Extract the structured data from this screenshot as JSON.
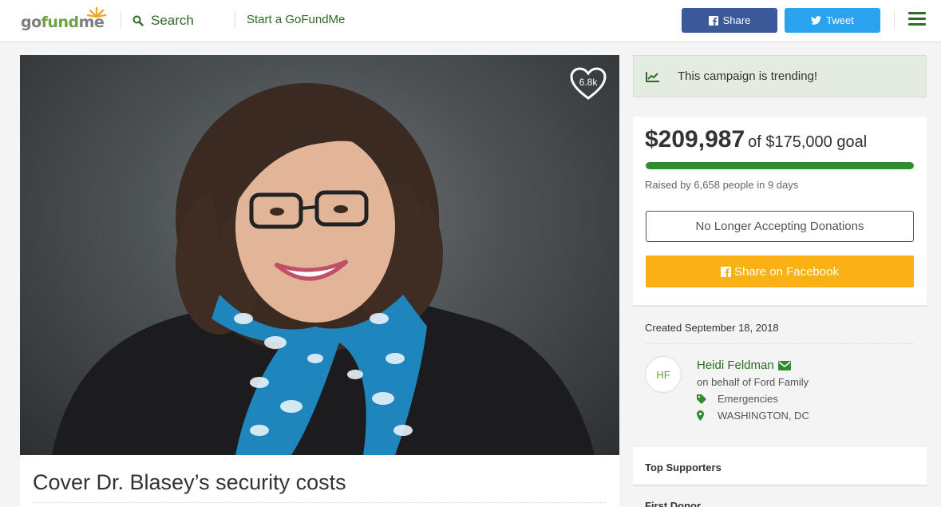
{
  "header": {
    "logo": {
      "go": "go",
      "fund": "fund",
      "me": "me"
    },
    "search_label": "Search",
    "start_label": "Start a GoFundMe",
    "share_label": "Share",
    "tweet_label": "Tweet",
    "colors": {
      "green": "#2d6c24",
      "facebook": "#3b5998",
      "twitter": "#2aa3ef"
    }
  },
  "campaign": {
    "heart_count": "6.8k",
    "title": "Cover Dr. Blasey’s security costs"
  },
  "trending": {
    "text": "This campaign is trending!"
  },
  "progress": {
    "raised": "$209,987",
    "goal_text": "of $175,000 goal",
    "fill_fraction": 1.0,
    "raised_by": "Raised by 6,658 people in 9 days",
    "closed_label": "No Longer Accepting Donations",
    "facebook_label": "Share on Facebook",
    "colors": {
      "bar": "#2f8c2b",
      "button": "#f9b115"
    }
  },
  "details": {
    "created": "Created September 18, 2018",
    "avatar_initials": "HF",
    "organizer": "Heidi Feldman",
    "behalf": "on behalf of Ford Family",
    "category": "Emergencies",
    "location": "WASHINGTON, DC"
  },
  "supporters": {
    "title": "Top Supporters",
    "first_donor": "First Donor"
  },
  "icons": [
    "search-icon",
    "facebook-icon",
    "twitter-icon",
    "hamburger-menu-icon",
    "heart-icon",
    "trending-chart-icon",
    "envelope-icon",
    "tag-icon",
    "map-marker-icon"
  ]
}
